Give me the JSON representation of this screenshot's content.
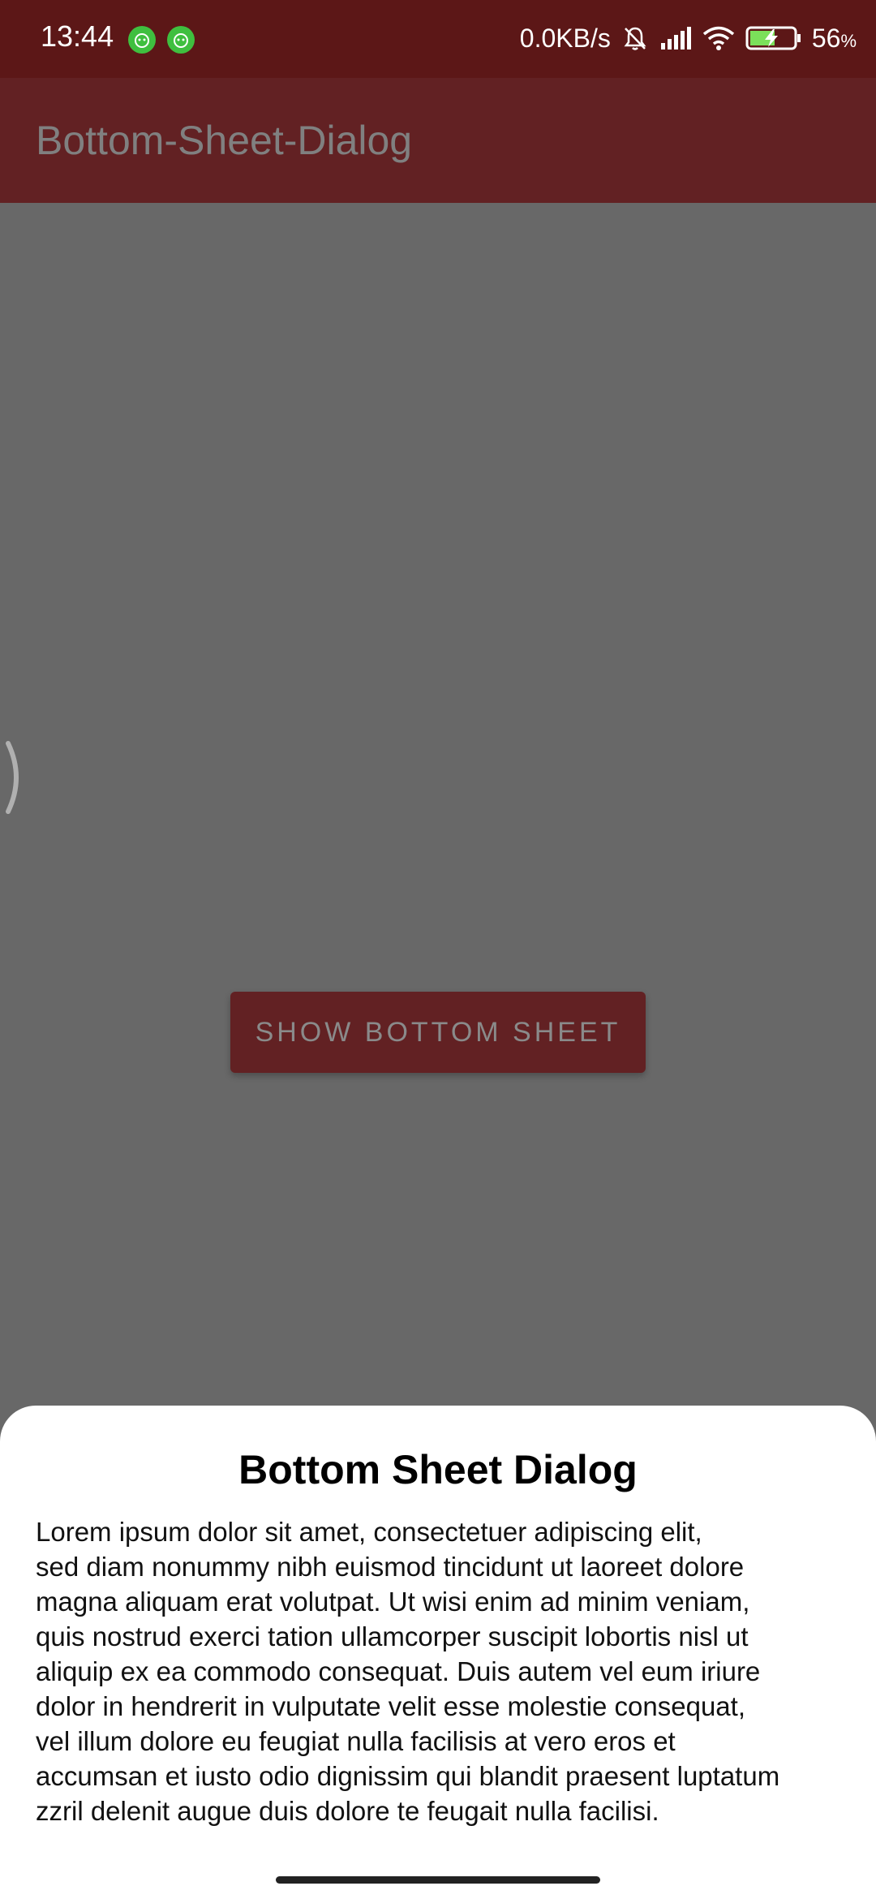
{
  "status_bar": {
    "time": "13:44",
    "net_speed": "0.0KB/s",
    "battery_percent": "56",
    "battery_unit": "%",
    "icons": [
      "app-notification-icon",
      "app-notification-icon",
      "mute-bell-icon",
      "signal-icon",
      "wifi-icon",
      "battery-charging-icon"
    ]
  },
  "app_bar": {
    "title": "Bottom-Sheet-Dialog"
  },
  "main": {
    "button_label": "SHOW BOTTOM SHEET"
  },
  "bottom_sheet": {
    "title": "Bottom Sheet Dialog",
    "body_lines": [
      "Lorem ipsum dolor sit amet, consectetuer adipiscing elit,",
      "sed diam nonummy nibh euismod tincidunt ut laoreet dolore",
      "magna aliquam erat volutpat. Ut wisi enim ad minim veniam,",
      "quis nostrud exerci tation ullamcorper suscipit lobortis nisl ut",
      "aliquip ex ea commodo consequat. Duis autem vel eum iriure",
      "dolor in hendrerit in vulputate velit esse molestie consequat,",
      "vel illum dolore eu feugiat nulla facilisis at vero eros et",
      "accumsan et iusto odio dignissim qui blandit praesent luptatum",
      "zzril delenit augue duis dolore te feugait nulla facilisi."
    ]
  },
  "colors": {
    "status_bar": "#5c1717",
    "app_bar_dimmed": "#622123",
    "scrim": "#686868",
    "sheet": "#ffffff"
  }
}
